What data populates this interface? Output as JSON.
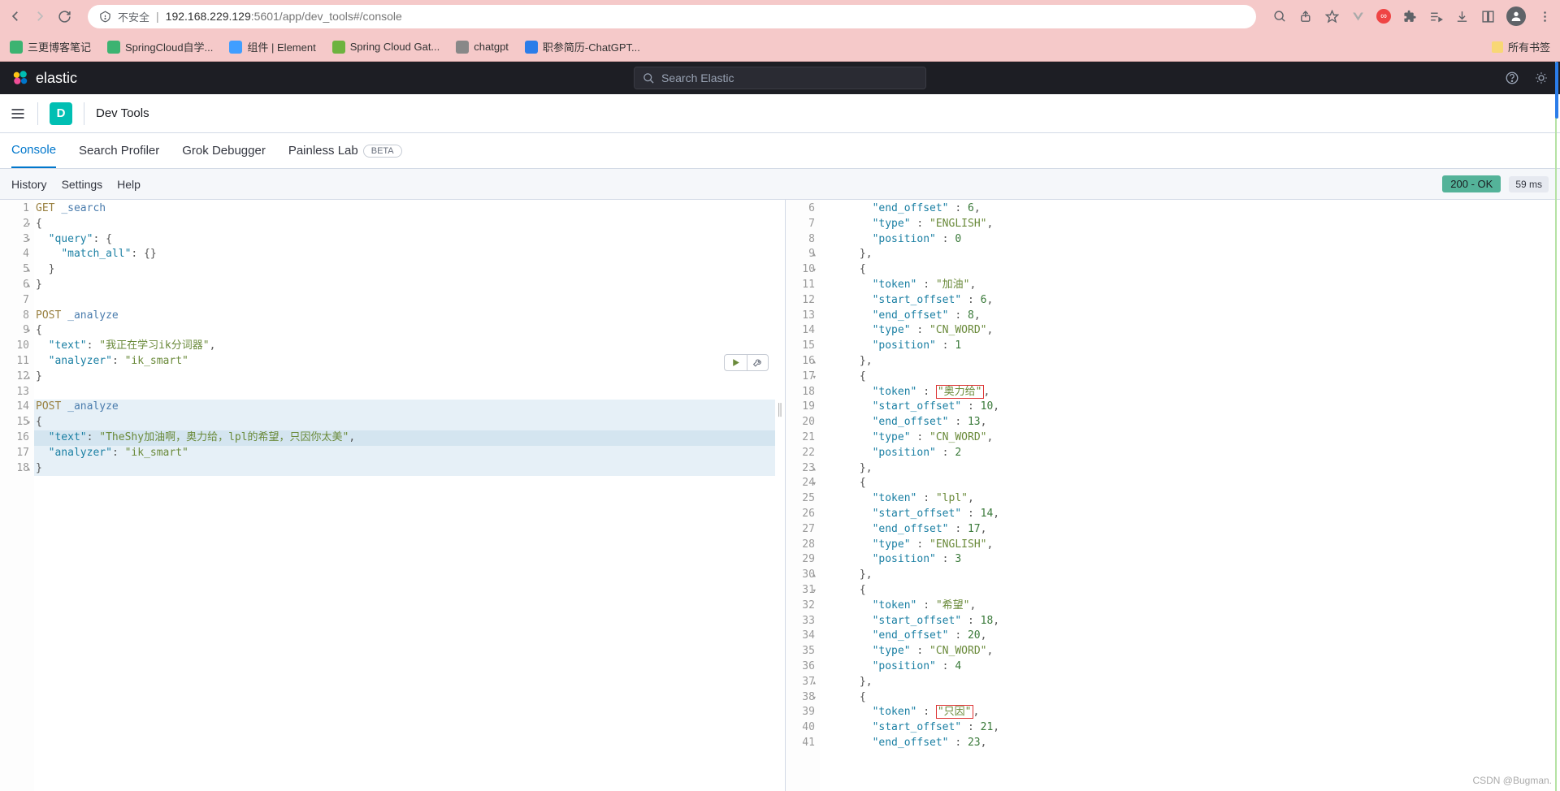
{
  "browser": {
    "insecure_label": "不安全",
    "url_host": "192.168.229.129",
    "url_port_path": ":5601/app/dev_tools#/console"
  },
  "bookmarks": {
    "items": [
      {
        "label": "三更博客笔记",
        "color": "#3cb371"
      },
      {
        "label": "SpringCloud自学...",
        "color": "#3cb371"
      },
      {
        "label": "组件 | Element",
        "color": "#409eff"
      },
      {
        "label": "Spring Cloud Gat...",
        "color": "#6db33f"
      },
      {
        "label": "chatgpt",
        "color": "#888"
      },
      {
        "label": "职参简历-ChatGPT...",
        "color": "#2b7de9"
      }
    ],
    "all_label": "所有书签"
  },
  "elastic_header": {
    "brand": "elastic",
    "search_placeholder": "Search Elastic"
  },
  "sub_header": {
    "badge": "D",
    "breadcrumb": "Dev Tools"
  },
  "tabs": {
    "items": [
      "Console",
      "Search Profiler",
      "Grok Debugger",
      "Painless Lab"
    ],
    "active_index": 0,
    "beta_label": "BETA"
  },
  "toolbar": {
    "items": [
      "History",
      "Settings",
      "Help"
    ],
    "status": "200 - OK",
    "timing": "59 ms"
  },
  "request_editor": {
    "lines": [
      {
        "n": "1",
        "fold": "",
        "type": "req",
        "method": "GET",
        "url": "_search"
      },
      {
        "n": "2",
        "fold": "▾",
        "type": "brace",
        "text": "{"
      },
      {
        "n": "3",
        "fold": "▾",
        "type": "kv",
        "indent": 1,
        "key": "query",
        "after": ": {"
      },
      {
        "n": "4",
        "fold": "",
        "type": "kv",
        "indent": 2,
        "key": "match_all",
        "after": ": {}"
      },
      {
        "n": "5",
        "fold": "▴",
        "type": "brace",
        "indent": 1,
        "text": "}"
      },
      {
        "n": "6",
        "fold": "▴",
        "type": "brace",
        "text": "}"
      },
      {
        "n": "7",
        "fold": "",
        "type": "blank"
      },
      {
        "n": "8",
        "fold": "",
        "type": "req",
        "method": "POST",
        "url": "_analyze"
      },
      {
        "n": "9",
        "fold": "▾",
        "type": "brace",
        "text": "{"
      },
      {
        "n": "10",
        "fold": "",
        "type": "kv",
        "indent": 1,
        "key": "text",
        "value": "我正在学习ik分词器",
        "comma": true
      },
      {
        "n": "11",
        "fold": "",
        "type": "kv",
        "indent": 1,
        "key": "analyzer",
        "value": "ik_smart"
      },
      {
        "n": "12",
        "fold": "▴",
        "type": "brace",
        "text": "}"
      },
      {
        "n": "13",
        "fold": "",
        "type": "blank"
      },
      {
        "n": "14",
        "fold": "",
        "type": "req",
        "method": "POST",
        "url": "_analyze",
        "hl": true
      },
      {
        "n": "15",
        "fold": "▾",
        "type": "brace",
        "text": "{",
        "hl": true
      },
      {
        "n": "16",
        "fold": "",
        "type": "kv",
        "indent": 1,
        "key": "text",
        "value": "TheShy加油啊，奥力给，lpl的希望，只因你太美",
        "comma": true,
        "hl": true,
        "hlstrong": true
      },
      {
        "n": "17",
        "fold": "",
        "type": "kv",
        "indent": 1,
        "key": "analyzer",
        "value": "ik_smart",
        "hl": true
      },
      {
        "n": "18",
        "fold": "▴",
        "type": "brace",
        "text": "}",
        "hl": true
      }
    ]
  },
  "response_editor": {
    "lines": [
      {
        "n": "6",
        "fold": "",
        "indent": 4,
        "segs": [
          {
            "k": "end_offset"
          },
          {
            "t": " : "
          },
          {
            "num": "6"
          },
          {
            "t": ","
          }
        ]
      },
      {
        "n": "7",
        "fold": "",
        "indent": 4,
        "segs": [
          {
            "k": "type"
          },
          {
            "t": " : "
          },
          {
            "s": "ENGLISH"
          },
          {
            "t": ","
          }
        ]
      },
      {
        "n": "8",
        "fold": "",
        "indent": 4,
        "segs": [
          {
            "k": "position"
          },
          {
            "t": " : "
          },
          {
            "num": "0"
          }
        ]
      },
      {
        "n": "9",
        "fold": "▴",
        "indent": 3,
        "segs": [
          {
            "t": "},"
          }
        ]
      },
      {
        "n": "10",
        "fold": "▾",
        "indent": 3,
        "segs": [
          {
            "t": "{"
          }
        ]
      },
      {
        "n": "11",
        "fold": "",
        "indent": 4,
        "segs": [
          {
            "k": "token"
          },
          {
            "t": " : "
          },
          {
            "s": "加油"
          },
          {
            "t": ","
          }
        ]
      },
      {
        "n": "12",
        "fold": "",
        "indent": 4,
        "segs": [
          {
            "k": "start_offset"
          },
          {
            "t": " : "
          },
          {
            "num": "6"
          },
          {
            "t": ","
          }
        ]
      },
      {
        "n": "13",
        "fold": "",
        "indent": 4,
        "segs": [
          {
            "k": "end_offset"
          },
          {
            "t": " : "
          },
          {
            "num": "8"
          },
          {
            "t": ","
          }
        ]
      },
      {
        "n": "14",
        "fold": "",
        "indent": 4,
        "segs": [
          {
            "k": "type"
          },
          {
            "t": " : "
          },
          {
            "s": "CN_WORD"
          },
          {
            "t": ","
          }
        ]
      },
      {
        "n": "15",
        "fold": "",
        "indent": 4,
        "segs": [
          {
            "k": "position"
          },
          {
            "t": " : "
          },
          {
            "num": "1"
          }
        ]
      },
      {
        "n": "16",
        "fold": "▴",
        "indent": 3,
        "segs": [
          {
            "t": "},"
          }
        ]
      },
      {
        "n": "17",
        "fold": "▾",
        "indent": 3,
        "segs": [
          {
            "t": "{"
          }
        ]
      },
      {
        "n": "18",
        "fold": "",
        "indent": 4,
        "segs": [
          {
            "k": "token"
          },
          {
            "t": " : "
          },
          {
            "s": "奥力给",
            "box": true
          },
          {
            "t": ","
          }
        ]
      },
      {
        "n": "19",
        "fold": "",
        "indent": 4,
        "segs": [
          {
            "k": "start_offset"
          },
          {
            "t": " : "
          },
          {
            "num": "10"
          },
          {
            "t": ","
          }
        ]
      },
      {
        "n": "20",
        "fold": "",
        "indent": 4,
        "segs": [
          {
            "k": "end_offset"
          },
          {
            "t": " : "
          },
          {
            "num": "13"
          },
          {
            "t": ","
          }
        ]
      },
      {
        "n": "21",
        "fold": "",
        "indent": 4,
        "segs": [
          {
            "k": "type"
          },
          {
            "t": " : "
          },
          {
            "s": "CN_WORD"
          },
          {
            "t": ","
          }
        ]
      },
      {
        "n": "22",
        "fold": "",
        "indent": 4,
        "segs": [
          {
            "k": "position"
          },
          {
            "t": " : "
          },
          {
            "num": "2"
          }
        ]
      },
      {
        "n": "23",
        "fold": "▴",
        "indent": 3,
        "segs": [
          {
            "t": "},"
          }
        ]
      },
      {
        "n": "24",
        "fold": "▾",
        "indent": 3,
        "segs": [
          {
            "t": "{"
          }
        ]
      },
      {
        "n": "25",
        "fold": "",
        "indent": 4,
        "segs": [
          {
            "k": "token"
          },
          {
            "t": " : "
          },
          {
            "s": "lpl"
          },
          {
            "t": ","
          }
        ]
      },
      {
        "n": "26",
        "fold": "",
        "indent": 4,
        "segs": [
          {
            "k": "start_offset"
          },
          {
            "t": " : "
          },
          {
            "num": "14"
          },
          {
            "t": ","
          }
        ]
      },
      {
        "n": "27",
        "fold": "",
        "indent": 4,
        "segs": [
          {
            "k": "end_offset"
          },
          {
            "t": " : "
          },
          {
            "num": "17"
          },
          {
            "t": ","
          }
        ]
      },
      {
        "n": "28",
        "fold": "",
        "indent": 4,
        "segs": [
          {
            "k": "type"
          },
          {
            "t": " : "
          },
          {
            "s": "ENGLISH"
          },
          {
            "t": ","
          }
        ]
      },
      {
        "n": "29",
        "fold": "",
        "indent": 4,
        "segs": [
          {
            "k": "position"
          },
          {
            "t": " : "
          },
          {
            "num": "3"
          }
        ]
      },
      {
        "n": "30",
        "fold": "▴",
        "indent": 3,
        "segs": [
          {
            "t": "},"
          }
        ]
      },
      {
        "n": "31",
        "fold": "▾",
        "indent": 3,
        "segs": [
          {
            "t": "{"
          }
        ]
      },
      {
        "n": "32",
        "fold": "",
        "indent": 4,
        "segs": [
          {
            "k": "token"
          },
          {
            "t": " : "
          },
          {
            "s": "希望"
          },
          {
            "t": ","
          }
        ]
      },
      {
        "n": "33",
        "fold": "",
        "indent": 4,
        "segs": [
          {
            "k": "start_offset"
          },
          {
            "t": " : "
          },
          {
            "num": "18"
          },
          {
            "t": ","
          }
        ]
      },
      {
        "n": "34",
        "fold": "",
        "indent": 4,
        "segs": [
          {
            "k": "end_offset"
          },
          {
            "t": " : "
          },
          {
            "num": "20"
          },
          {
            "t": ","
          }
        ]
      },
      {
        "n": "35",
        "fold": "",
        "indent": 4,
        "segs": [
          {
            "k": "type"
          },
          {
            "t": " : "
          },
          {
            "s": "CN_WORD"
          },
          {
            "t": ","
          }
        ]
      },
      {
        "n": "36",
        "fold": "",
        "indent": 4,
        "segs": [
          {
            "k": "position"
          },
          {
            "t": " : "
          },
          {
            "num": "4"
          }
        ]
      },
      {
        "n": "37",
        "fold": "▴",
        "indent": 3,
        "segs": [
          {
            "t": "},"
          }
        ]
      },
      {
        "n": "38",
        "fold": "▾",
        "indent": 3,
        "segs": [
          {
            "t": "{"
          }
        ]
      },
      {
        "n": "39",
        "fold": "",
        "indent": 4,
        "segs": [
          {
            "k": "token"
          },
          {
            "t": " : "
          },
          {
            "s": "只因",
            "box": true
          },
          {
            "t": ","
          }
        ]
      },
      {
        "n": "40",
        "fold": "",
        "indent": 4,
        "segs": [
          {
            "k": "start_offset"
          },
          {
            "t": " : "
          },
          {
            "num": "21"
          },
          {
            "t": ","
          }
        ]
      },
      {
        "n": "41",
        "fold": "",
        "indent": 4,
        "segs": [
          {
            "k": "end_offset"
          },
          {
            "t": " : "
          },
          {
            "num": "23"
          },
          {
            "t": ","
          }
        ]
      }
    ]
  },
  "watermark": "CSDN @Bugman."
}
